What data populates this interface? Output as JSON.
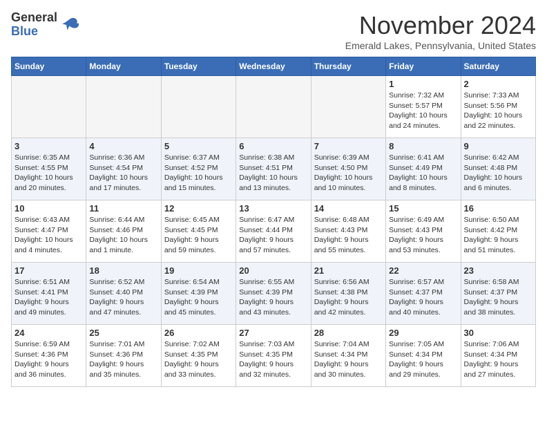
{
  "logo": {
    "general": "General",
    "blue": "Blue"
  },
  "header": {
    "month": "November 2024",
    "location": "Emerald Lakes, Pennsylvania, United States"
  },
  "weekdays": [
    "Sunday",
    "Monday",
    "Tuesday",
    "Wednesday",
    "Thursday",
    "Friday",
    "Saturday"
  ],
  "weeks": [
    [
      {
        "day": "",
        "info": ""
      },
      {
        "day": "",
        "info": ""
      },
      {
        "day": "",
        "info": ""
      },
      {
        "day": "",
        "info": ""
      },
      {
        "day": "",
        "info": ""
      },
      {
        "day": "1",
        "info": "Sunrise: 7:32 AM\nSunset: 5:57 PM\nDaylight: 10 hours\nand 24 minutes."
      },
      {
        "day": "2",
        "info": "Sunrise: 7:33 AM\nSunset: 5:56 PM\nDaylight: 10 hours\nand 22 minutes."
      }
    ],
    [
      {
        "day": "3",
        "info": "Sunrise: 6:35 AM\nSunset: 4:55 PM\nDaylight: 10 hours\nand 20 minutes."
      },
      {
        "day": "4",
        "info": "Sunrise: 6:36 AM\nSunset: 4:54 PM\nDaylight: 10 hours\nand 17 minutes."
      },
      {
        "day": "5",
        "info": "Sunrise: 6:37 AM\nSunset: 4:52 PM\nDaylight: 10 hours\nand 15 minutes."
      },
      {
        "day": "6",
        "info": "Sunrise: 6:38 AM\nSunset: 4:51 PM\nDaylight: 10 hours\nand 13 minutes."
      },
      {
        "day": "7",
        "info": "Sunrise: 6:39 AM\nSunset: 4:50 PM\nDaylight: 10 hours\nand 10 minutes."
      },
      {
        "day": "8",
        "info": "Sunrise: 6:41 AM\nSunset: 4:49 PM\nDaylight: 10 hours\nand 8 minutes."
      },
      {
        "day": "9",
        "info": "Sunrise: 6:42 AM\nSunset: 4:48 PM\nDaylight: 10 hours\nand 6 minutes."
      }
    ],
    [
      {
        "day": "10",
        "info": "Sunrise: 6:43 AM\nSunset: 4:47 PM\nDaylight: 10 hours\nand 4 minutes."
      },
      {
        "day": "11",
        "info": "Sunrise: 6:44 AM\nSunset: 4:46 PM\nDaylight: 10 hours\nand 1 minute."
      },
      {
        "day": "12",
        "info": "Sunrise: 6:45 AM\nSunset: 4:45 PM\nDaylight: 9 hours\nand 59 minutes."
      },
      {
        "day": "13",
        "info": "Sunrise: 6:47 AM\nSunset: 4:44 PM\nDaylight: 9 hours\nand 57 minutes."
      },
      {
        "day": "14",
        "info": "Sunrise: 6:48 AM\nSunset: 4:43 PM\nDaylight: 9 hours\nand 55 minutes."
      },
      {
        "day": "15",
        "info": "Sunrise: 6:49 AM\nSunset: 4:43 PM\nDaylight: 9 hours\nand 53 minutes."
      },
      {
        "day": "16",
        "info": "Sunrise: 6:50 AM\nSunset: 4:42 PM\nDaylight: 9 hours\nand 51 minutes."
      }
    ],
    [
      {
        "day": "17",
        "info": "Sunrise: 6:51 AM\nSunset: 4:41 PM\nDaylight: 9 hours\nand 49 minutes."
      },
      {
        "day": "18",
        "info": "Sunrise: 6:52 AM\nSunset: 4:40 PM\nDaylight: 9 hours\nand 47 minutes."
      },
      {
        "day": "19",
        "info": "Sunrise: 6:54 AM\nSunset: 4:39 PM\nDaylight: 9 hours\nand 45 minutes."
      },
      {
        "day": "20",
        "info": "Sunrise: 6:55 AM\nSunset: 4:39 PM\nDaylight: 9 hours\nand 43 minutes."
      },
      {
        "day": "21",
        "info": "Sunrise: 6:56 AM\nSunset: 4:38 PM\nDaylight: 9 hours\nand 42 minutes."
      },
      {
        "day": "22",
        "info": "Sunrise: 6:57 AM\nSunset: 4:37 PM\nDaylight: 9 hours\nand 40 minutes."
      },
      {
        "day": "23",
        "info": "Sunrise: 6:58 AM\nSunset: 4:37 PM\nDaylight: 9 hours\nand 38 minutes."
      }
    ],
    [
      {
        "day": "24",
        "info": "Sunrise: 6:59 AM\nSunset: 4:36 PM\nDaylight: 9 hours\nand 36 minutes."
      },
      {
        "day": "25",
        "info": "Sunrise: 7:01 AM\nSunset: 4:36 PM\nDaylight: 9 hours\nand 35 minutes."
      },
      {
        "day": "26",
        "info": "Sunrise: 7:02 AM\nSunset: 4:35 PM\nDaylight: 9 hours\nand 33 minutes."
      },
      {
        "day": "27",
        "info": "Sunrise: 7:03 AM\nSunset: 4:35 PM\nDaylight: 9 hours\nand 32 minutes."
      },
      {
        "day": "28",
        "info": "Sunrise: 7:04 AM\nSunset: 4:34 PM\nDaylight: 9 hours\nand 30 minutes."
      },
      {
        "day": "29",
        "info": "Sunrise: 7:05 AM\nSunset: 4:34 PM\nDaylight: 9 hours\nand 29 minutes."
      },
      {
        "day": "30",
        "info": "Sunrise: 7:06 AM\nSunset: 4:34 PM\nDaylight: 9 hours\nand 27 minutes."
      }
    ]
  ]
}
